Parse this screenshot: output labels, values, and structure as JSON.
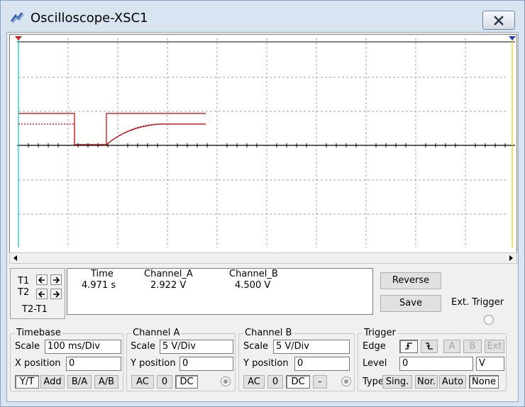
{
  "window": {
    "title": "Oscilloscope-XSC1"
  },
  "cursors": {
    "t1_label": "T1",
    "t2_label": "T2",
    "diff_label": "T2-T1"
  },
  "readout": {
    "headers": [
      "Time",
      "Channel_A",
      "Channel_B"
    ],
    "values": [
      "4.971 s",
      "2.922 V",
      "4.500 V"
    ]
  },
  "buttons": {
    "reverse": "Reverse",
    "save": "Save"
  },
  "ext_trigger": {
    "label": "Ext. Trigger"
  },
  "timebase": {
    "title": "Timebase",
    "scale_label": "Scale",
    "scale_value": "100 ms/Div",
    "xpos_label": "X position",
    "xpos_value": "0",
    "modes": [
      "Y/T",
      "Add",
      "B/A",
      "A/B"
    ],
    "active_mode": "Y/T"
  },
  "channel_a": {
    "title": "Channel A",
    "scale_label": "Scale",
    "scale_value": "5  V/Div",
    "ypos_label": "Y position",
    "ypos_value": "0",
    "coupling": [
      "AC",
      "0",
      "DC"
    ],
    "active_coupling": "DC"
  },
  "channel_b": {
    "title": "Channel B",
    "scale_label": "Scale",
    "scale_value": "5  V/Div",
    "ypos_label": "Y position",
    "ypos_value": "0",
    "coupling": [
      "AC",
      "0",
      "DC",
      "-"
    ],
    "active_coupling": "DC"
  },
  "trigger": {
    "title": "Trigger",
    "edge_label": "Edge",
    "sources": [
      "A",
      "B",
      "Ext"
    ],
    "level_label": "Level",
    "level_value": "0",
    "level_unit": "V",
    "type_label": "Type",
    "types": [
      "Sing.",
      "Nor.",
      "Auto",
      "None"
    ],
    "active_type": "None"
  },
  "colors": {
    "trace_a": "#c00000",
    "cursor_t1": "#00c8d8",
    "cursor_t2": "#f0d000",
    "grid": "#a0a0a0"
  }
}
